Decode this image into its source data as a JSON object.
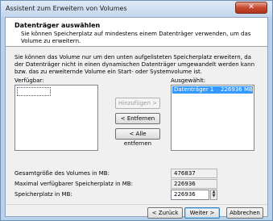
{
  "window": {
    "title": "Assistent zum Erweitern von Volumes",
    "close": "✕"
  },
  "header": {
    "title": "Datenträger auswählen",
    "subtitle": "Sie können Speicherplatz auf mindestens einem Datenträger verwenden, um das Volume zu erweitern."
  },
  "intro": "Sie können das Volume nur um den unten aufgelisteten Speicherplatz erweitern, da der Datenträger nicht in einen dynamischen Datenträger umgewandelt werden kann bzw. das zu erweiternde Volume ein Start- oder Systemvolume ist.",
  "available": {
    "label": "Verfügbar:",
    "items": []
  },
  "selected": {
    "label": "Ausgewählt:",
    "items": [
      {
        "name": "Datenträger 1",
        "size": "226936 MB"
      }
    ]
  },
  "buttons": {
    "add": "Hinzufügen >",
    "remove": "< Entfernen",
    "remove_all": "< Alle entfernen",
    "back": "< Zurück",
    "next": "Weiter >",
    "cancel": "Abbrechen"
  },
  "fields": {
    "total_label": "Gesamtgröße des Volumes in MB:",
    "total_value": "476837",
    "max_label": "Maximal verfügbarer Speicherplatz in MB:",
    "max_value": "226936",
    "space_label": "Speicherplatz in MB:",
    "space_value": "226936"
  }
}
